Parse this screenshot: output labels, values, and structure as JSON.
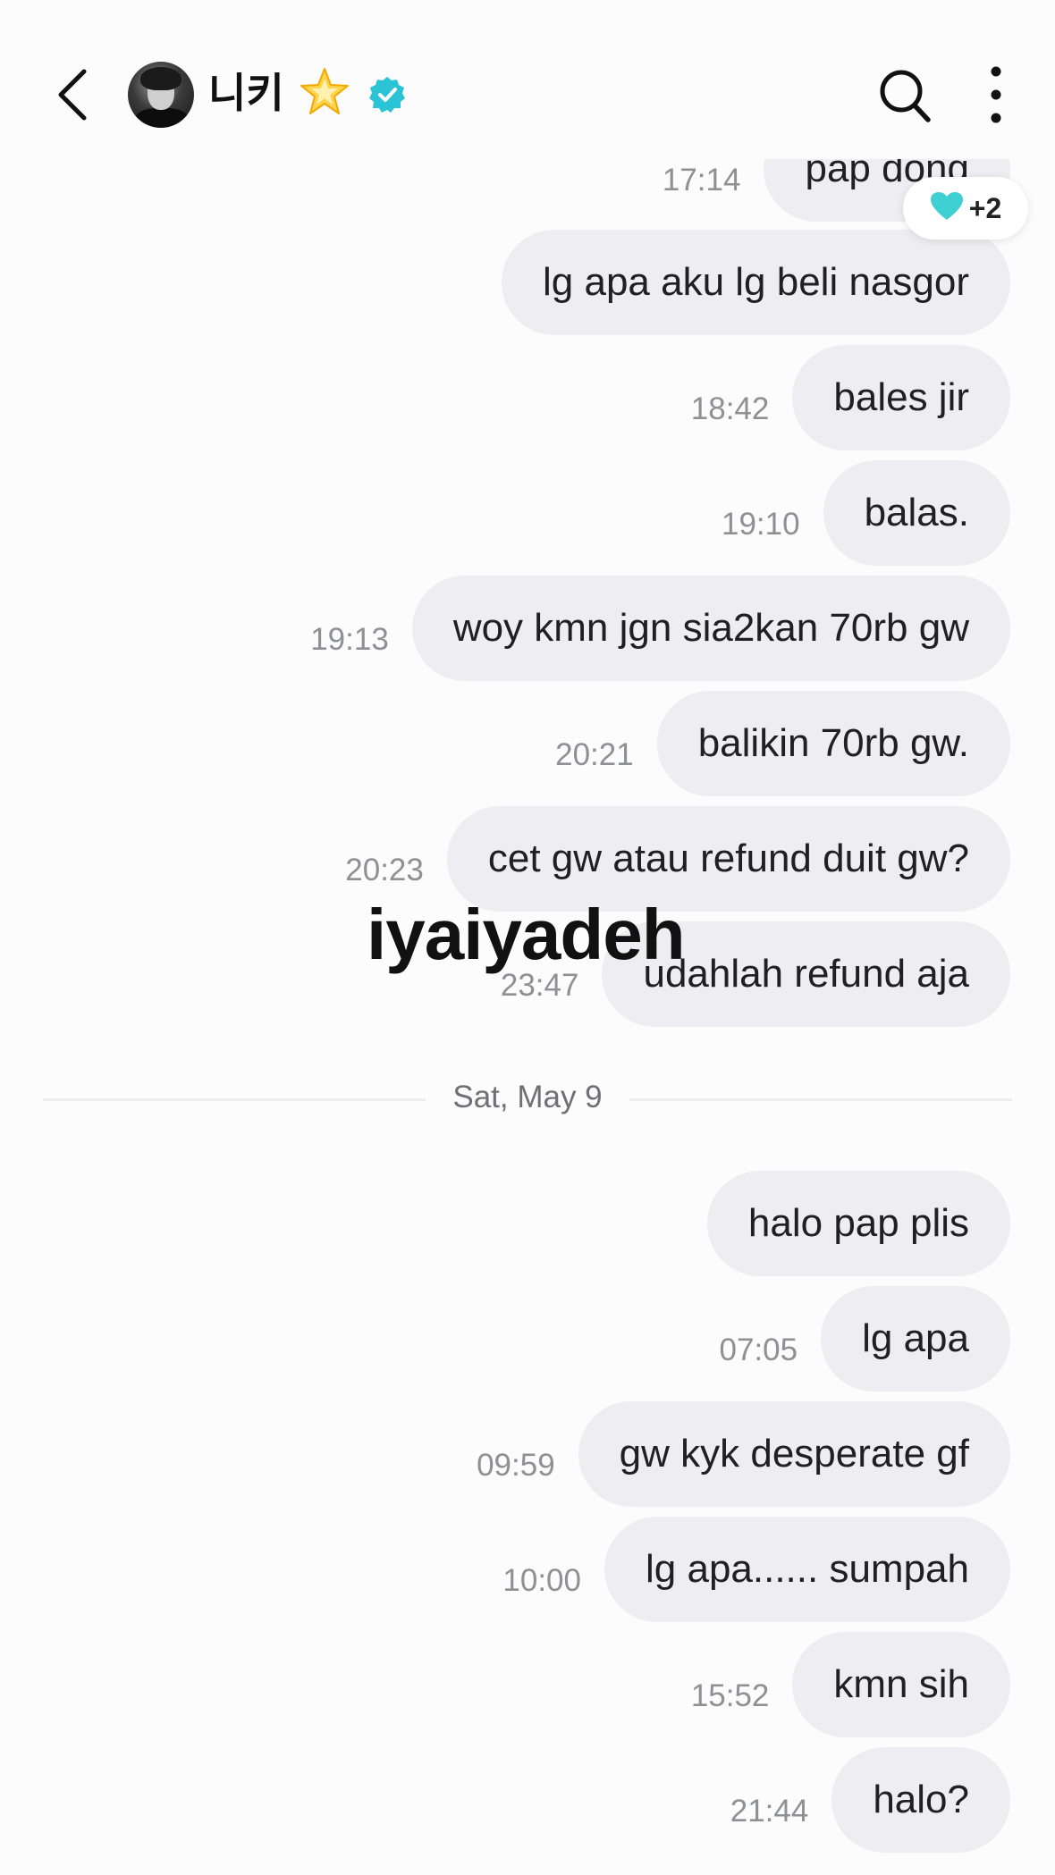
{
  "header": {
    "title": "니키",
    "icons": [
      "back-icon",
      "avatar",
      "star-icon",
      "verified-icon",
      "search-icon",
      "more-icon"
    ],
    "verified_color": "#2bc4d6"
  },
  "reaction": {
    "icon": "heart-icon",
    "count": "+2",
    "color": "#3fd0d4"
  },
  "messages": [
    {
      "time": "17:14",
      "text": "pap dong"
    },
    {
      "time": "",
      "text": "lg apa aku lg beli nasgor"
    },
    {
      "time": "18:42",
      "text": "bales jir"
    },
    {
      "time": "19:10",
      "text": "balas."
    },
    {
      "time": "19:13",
      "text": "woy kmn jgn sia2kan 70rb gw"
    },
    {
      "time": "20:21",
      "text": "balikin 70rb gw."
    },
    {
      "time": "20:23",
      "text": "cet gw atau refund duit gw?"
    },
    {
      "time": "23:47",
      "text": "udahlah refund aja"
    }
  ],
  "date_divider": "Sat, May 9",
  "messages_day2": [
    {
      "time": "",
      "text": "halo pap plis"
    },
    {
      "time": "07:05",
      "text": "lg apa"
    },
    {
      "time": "09:59",
      "text": "gw kyk desperate gf"
    },
    {
      "time": "10:00",
      "text": "lg apa...... sumpah"
    },
    {
      "time": "15:52",
      "text": "kmn sih"
    },
    {
      "time": "21:44",
      "text": "halo?"
    }
  ],
  "overlay_caption": "iyaiyadeh"
}
